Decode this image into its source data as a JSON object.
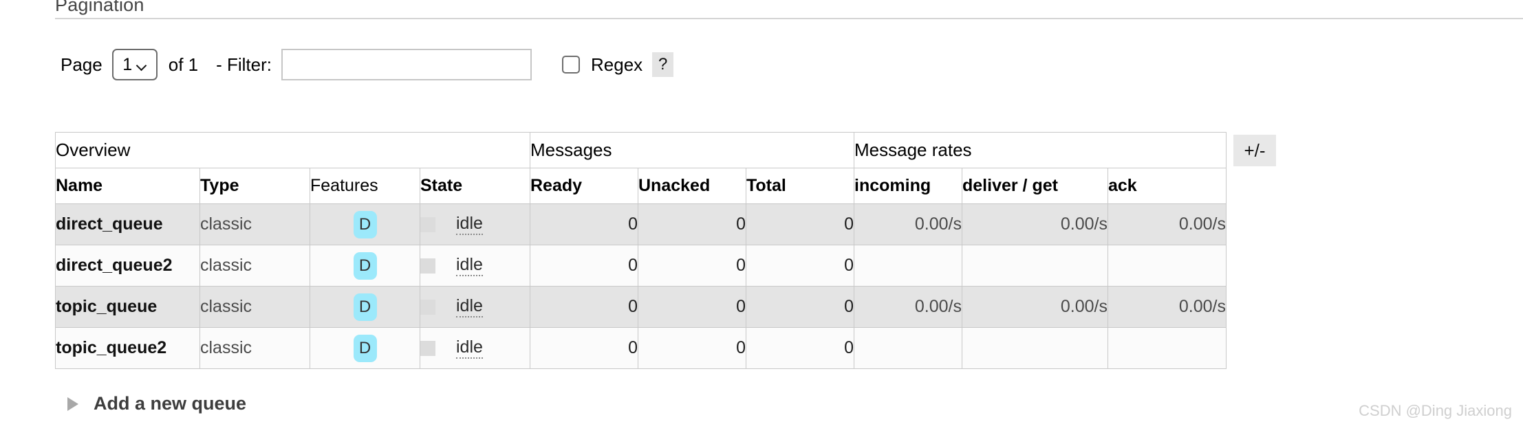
{
  "section": {
    "heading": "Pagination"
  },
  "pagination": {
    "page_label": "Page",
    "page_value": "1",
    "page_options": [
      "1"
    ],
    "of_text": "of 1",
    "filter_label": "- Filter:",
    "filter_value": "",
    "filter_placeholder": "",
    "regex_label": "Regex",
    "regex_checked": false,
    "help_label": "?"
  },
  "table": {
    "group_headers": [
      {
        "label": "Overview",
        "span": 4
      },
      {
        "label": "Messages",
        "span": 3
      },
      {
        "label": "Message rates",
        "span": 3
      }
    ],
    "columns": [
      {
        "key": "name",
        "label": "Name",
        "sortable": true,
        "align": "left"
      },
      {
        "key": "type",
        "label": "Type",
        "sortable": true,
        "align": "left"
      },
      {
        "key": "features",
        "label": "Features",
        "sortable": false,
        "align": "left"
      },
      {
        "key": "state",
        "label": "State",
        "sortable": true,
        "align": "left"
      },
      {
        "key": "ready",
        "label": "Ready",
        "sortable": true,
        "align": "left"
      },
      {
        "key": "unacked",
        "label": "Unacked",
        "sortable": true,
        "align": "left"
      },
      {
        "key": "total",
        "label": "Total",
        "sortable": true,
        "align": "left"
      },
      {
        "key": "incoming",
        "label": "incoming",
        "sortable": true,
        "align": "left"
      },
      {
        "key": "deliver",
        "label": "deliver / get",
        "sortable": true,
        "align": "left"
      },
      {
        "key": "ack",
        "label": "ack",
        "sortable": true,
        "align": "left"
      }
    ],
    "rows": [
      {
        "name": "direct_queue",
        "type": "classic",
        "features": "D",
        "state": "idle",
        "ready": "0",
        "unacked": "0",
        "total": "0",
        "incoming": "0.00/s",
        "deliver": "0.00/s",
        "ack": "0.00/s"
      },
      {
        "name": "direct_queue2",
        "type": "classic",
        "features": "D",
        "state": "idle",
        "ready": "0",
        "unacked": "0",
        "total": "0",
        "incoming": "",
        "deliver": "",
        "ack": ""
      },
      {
        "name": "topic_queue",
        "type": "classic",
        "features": "D",
        "state": "idle",
        "ready": "0",
        "unacked": "0",
        "total": "0",
        "incoming": "0.00/s",
        "deliver": "0.00/s",
        "ack": "0.00/s"
      },
      {
        "name": "topic_queue2",
        "type": "classic",
        "features": "D",
        "state": "idle",
        "ready": "0",
        "unacked": "0",
        "total": "0",
        "incoming": "",
        "deliver": "",
        "ack": ""
      }
    ],
    "toggle_columns_label": "+/-"
  },
  "add_queue": {
    "label": "Add a new queue",
    "expanded": false
  },
  "watermark": {
    "text": "CSDN @Ding Jiaxiong"
  },
  "colors": {
    "feature_badge_bg": "#9ce9fb",
    "state_swatch": "#dcdcdc",
    "row_odd_bg": "#e4e4e4",
    "row_even_bg": "#fbfbfb",
    "border": "#c8c8c8",
    "heading_text": "#444444",
    "watermark_text": "#cfcfcf"
  }
}
